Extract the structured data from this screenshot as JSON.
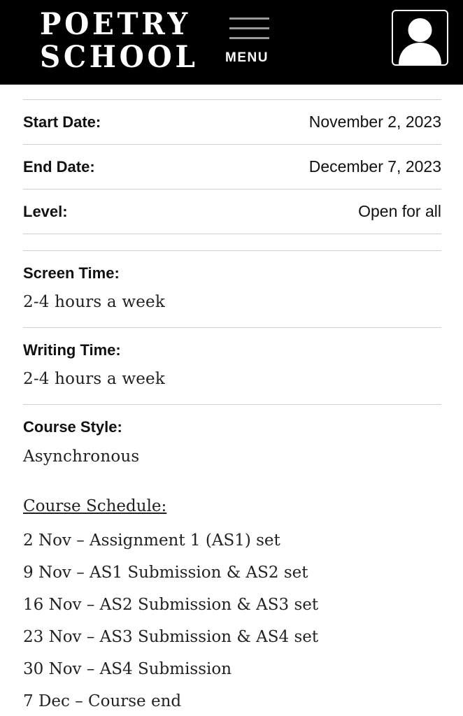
{
  "header": {
    "logo_line1": "POETRY",
    "logo_line2": "SCHOOL",
    "menu_label": "MENU",
    "icons": {
      "menu": "hamburger-icon",
      "account": "user-icon"
    },
    "background": "#000000"
  },
  "details": {
    "start_date": {
      "label": "Start Date:",
      "value": "November 2, 2023"
    },
    "end_date": {
      "label": "End Date:",
      "value": "December 7, 2023"
    },
    "level": {
      "label": "Level:",
      "value": "Open for all"
    }
  },
  "info": {
    "screen_time": {
      "label": "Screen Time:",
      "value": "2-4 hours a week"
    },
    "writing_time": {
      "label": "Writing Time:",
      "value": "2-4 hours a week"
    },
    "course_style": {
      "label": "Course Style:",
      "value": "Asynchronous"
    }
  },
  "schedule": {
    "title": "Course Schedule:",
    "items": [
      "2 Nov – Assignment 1 (AS1) set",
      "9 Nov – AS1 Submission & AS2 set",
      "16 Nov – AS2 Submission & AS3 set",
      "23 Nov – AS3 Submission & AS4 set",
      "30 Nov – AS4 Submission",
      "7 Dec – Course end"
    ]
  }
}
